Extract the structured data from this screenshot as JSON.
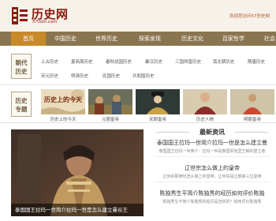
{
  "brand": {
    "name": "历史网",
    "url": "57lishi.com"
  },
  "header": {
    "welcome": "欢迎您访问57历史网"
  },
  "nav": {
    "items": [
      {
        "label": "首页",
        "active": true
      },
      {
        "label": "中国历史",
        "active": false
      },
      {
        "label": "世界历史",
        "active": false
      },
      {
        "label": "探索发现",
        "active": false
      },
      {
        "label": "历史文化",
        "active": false
      },
      {
        "label": "百家哲学",
        "active": false
      },
      {
        "label": "社会",
        "active": false
      }
    ]
  },
  "dynasties": {
    "label_line1": "朝代",
    "label_line2": "历史",
    "rows": [
      [
        "上古历史",
        "夏商周历史",
        "春秋战国历史",
        "秦汉历史",
        "三国两晋历史",
        "南北朝历史",
        "隋唐历史"
      ],
      [
        "宋元历史",
        "明清历史",
        "民国历史",
        "共和国历史"
      ]
    ]
  },
  "topics": {
    "label_line1": "历史",
    "label_line2": "专题",
    "items": [
      {
        "caption": "历史上的今天",
        "banner": "历史上的今天"
      },
      {
        "caption": "元朝皇帝"
      },
      {
        "caption": "宋朝皇帝"
      },
      {
        "caption": "历史人物"
      },
      {
        "caption": "明朝皇帝"
      }
    ]
  },
  "feature": {
    "caption": "泰国国王拉玛一世简介拉玛一世是怎么建立曼谷王"
  },
  "news": {
    "title": "最新资讯",
    "items": [
      {
        "headline": "泰国国王拉玛一世简介拉玛一世是怎么建立曼",
        "summary": "泰国国王拉玛一世简介：拉玛一世是泰国却克里王朝的建立者"
      },
      {
        "headline": "辽世宗怎么做上的皇帝",
        "summary": "辽世宗耶律阮怎么做上的皇帝，辽世宗是辽朝第三位皇帝"
      },
      {
        "headline": "陈独秀生平简介陈独秀的经历如何评价陈独",
        "summary": "陈独秀生平简介陈独秀的经历是怎样的？如何评价陈独秀"
      }
    ]
  },
  "colors": {
    "brand_red": "#8b1a10",
    "nav_bg": "#8a7550",
    "nav_active": "#c8892a"
  }
}
